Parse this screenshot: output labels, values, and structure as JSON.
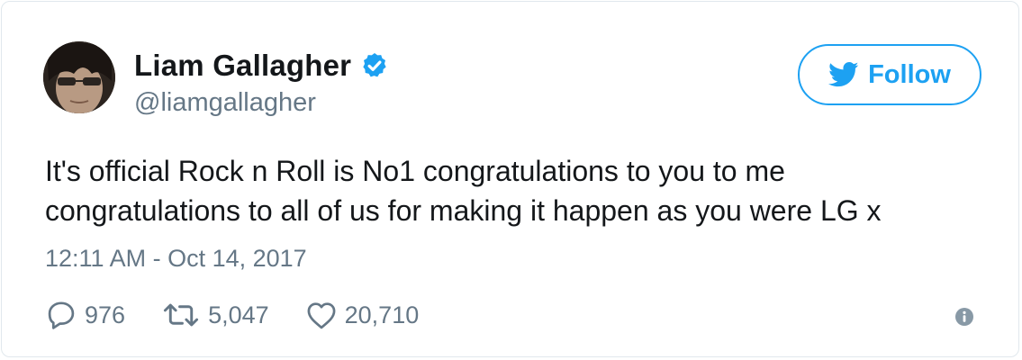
{
  "user": {
    "name": "Liam Gallagher",
    "handle": "@liamgallagher",
    "verified": true
  },
  "follow_button": {
    "label": "Follow"
  },
  "tweet": {
    "text_lines": [
      "It's official Rock n Roll is No1 congratulations to you to me",
      "congratulations to all of us for making it happen as you were LG x"
    ],
    "timestamp": "12:11 AM - Oct 14, 2017"
  },
  "actions": {
    "replies": "976",
    "retweets": "5,047",
    "likes": "20,710"
  },
  "icons": {
    "verified": "verified-badge-icon",
    "follow": "twitter-bird-icon",
    "reply": "reply-icon",
    "retweet": "retweet-icon",
    "like": "heart-icon",
    "info": "info-icon"
  },
  "colors": {
    "accent": "#1da1f2",
    "text": "#14171a",
    "muted": "#657786",
    "border": "#e1e8ed"
  }
}
